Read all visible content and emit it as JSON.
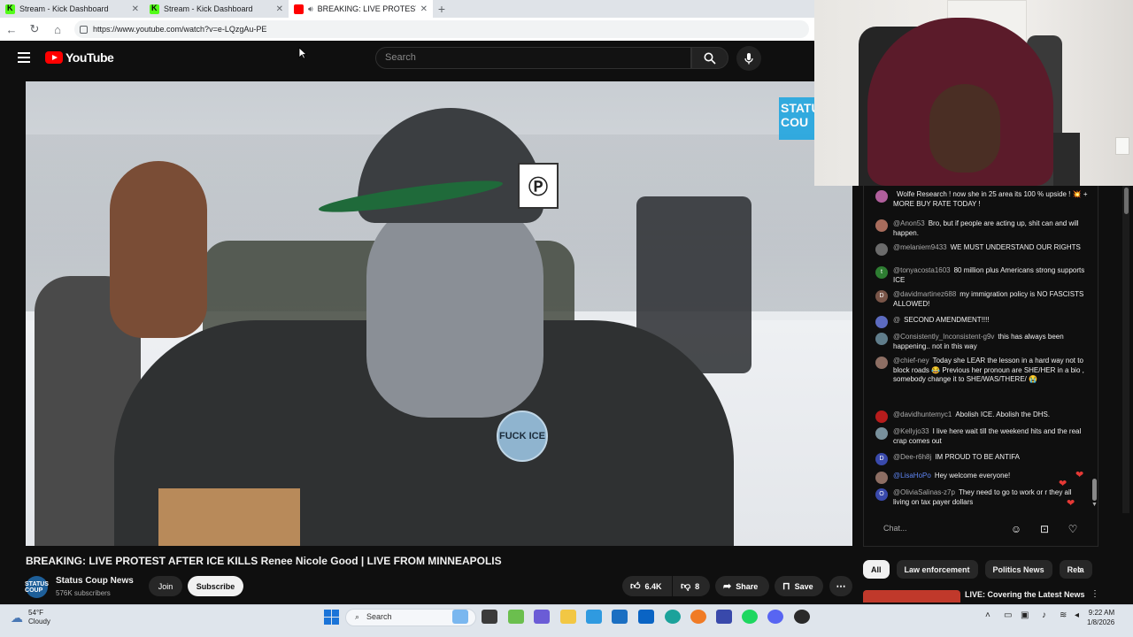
{
  "browser": {
    "tabs": [
      {
        "title": "Stream - Kick Dashboard",
        "icon": "kick-icon",
        "active": false
      },
      {
        "title": "Stream - Kick Dashboard",
        "icon": "kick-icon",
        "active": false
      },
      {
        "title": "BREAKING: LIVE PROTEST AFT",
        "icon": "youtube-icon",
        "active": true
      }
    ],
    "url": "https://www.youtube.com/watch?v=e-LQzgAu-PE"
  },
  "header": {
    "logo_text": "YouTube",
    "search_placeholder": "Search"
  },
  "video": {
    "title": "BREAKING: LIVE PROTEST AFTER ICE KILLS Renee Nicole Good | LIVE FROM MINNEAPOLIS",
    "overlay_badge": "FUCK ICE",
    "overlay_logo": "STATUS COU"
  },
  "channel": {
    "name": "Status Coup News",
    "subscribers": "576K subscribers",
    "avatar_text": "STATUS COUP",
    "join_label": "Join",
    "subscribe_label": "Subscribe"
  },
  "actions": {
    "likes": "6.4K",
    "dislikes": "8",
    "share_label": "Share",
    "save_label": "Save"
  },
  "chat": {
    "messages": [
      {
        "author": "",
        "text": "Wolfe Research ! now she in 25 area its 100 % upside ! 💥 + MORE BUY RATE TODAY !",
        "avatar_color": "#b05f9c"
      },
      {
        "author": "@Anon53",
        "text": "Bro, but if people are acting up, shit can and will happen.",
        "avatar_color": "#a86c5c"
      },
      {
        "author": "@melaniem9433",
        "text": "WE MUST UNDERSTAND OUR RIGHTS",
        "avatar_color": "#6b6b6b"
      },
      {
        "author": "@tonyacosta1603",
        "text": "80 million plus Americans strong supports ICE",
        "avatar_color": "#2e7d32",
        "initial": "t"
      },
      {
        "author": "@davidmartinez688",
        "text": "my immigration policy is NO FASCISTS ALLOWED!",
        "avatar_color": "#795548",
        "initial": "D"
      },
      {
        "author": "@",
        "text": "SECOND AMENDMENT!!!!",
        "avatar_color": "#5c6bc0"
      },
      {
        "author": "@Consistently_Inconsistent-g9v",
        "text": "this has always been happening.. not in this way",
        "avatar_color": "#607d8b"
      },
      {
        "author": "@chief-ney",
        "text": "Today she LEAR the lesson in a hard way not to block roads 😂 Previous her pronoun are SHE/HER in a bio , somebody change it to SHE/WAS/THERE/ 😭",
        "avatar_color": "#8d6e63"
      },
      {
        "author": "@davidhuntemyc1",
        "text": "Abolish ICE. Abolish the DHS.",
        "avatar_color": "#b71c1c"
      },
      {
        "author": "@Kellyjo33",
        "text": "I live here wait till the weekend hits and the real crap comes out",
        "avatar_color": "#78909c"
      },
      {
        "author": "@Dee-r6h8j",
        "text": "IM PROUD TO BE ANTIFA",
        "avatar_color": "#3949ab",
        "initial": "D"
      },
      {
        "author": "@LisaHoPo",
        "text": "Hey welcome everyone!",
        "avatar_color": "#8d6e63",
        "moderator": true
      },
      {
        "author": "@OliviaSalinas-z7p",
        "text": "They need to go to work or r they all living on tax payer dollars",
        "avatar_color": "#3949ab",
        "initial": "O"
      }
    ],
    "input_placeholder": "Chat..."
  },
  "chips": [
    "All",
    "Law enforcement",
    "Politics News",
    "Rela"
  ],
  "recommended": {
    "title": "LIVE: Covering the Latest News"
  },
  "taskbar": {
    "temperature": "54°F",
    "condition": "Cloudy",
    "search_label": "Search",
    "time": "9:22 AM",
    "date": "1/8/2026"
  }
}
